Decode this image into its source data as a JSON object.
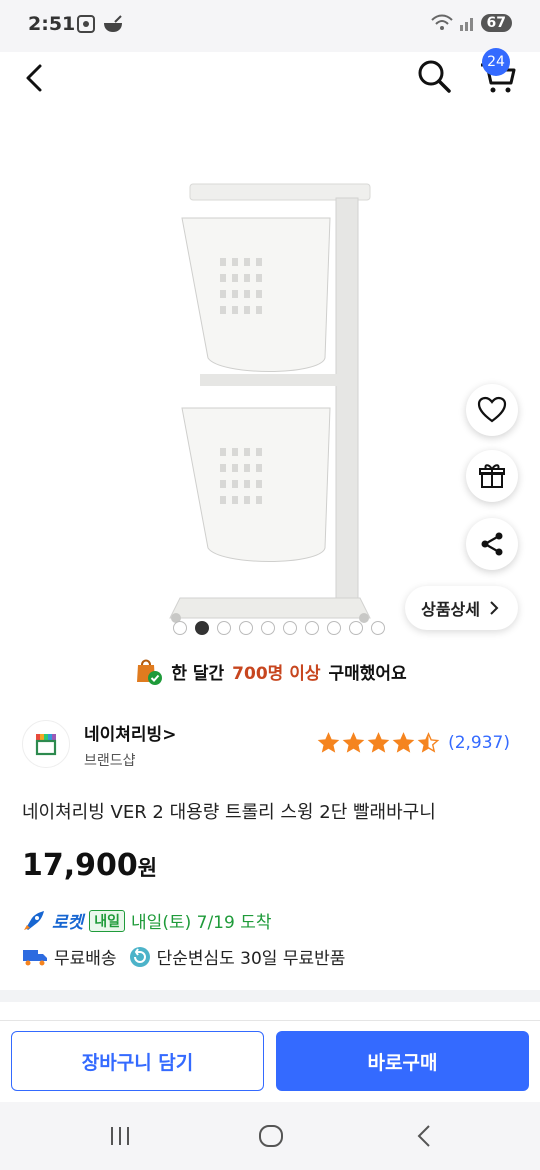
{
  "status_bar": {
    "time": "2:51",
    "battery": "67"
  },
  "header": {
    "cart_count": "24"
  },
  "gallery": {
    "total_images": 10,
    "active_index": 1
  },
  "actions": {
    "detail_label": "상품상세"
  },
  "purchase_banner": {
    "prefix": "한 달간",
    "highlight": "700명 이상",
    "suffix": "구매했어요"
  },
  "brand": {
    "name": "네이쳐리빙",
    "chevron": ">",
    "sub": "브랜드샵"
  },
  "rating": {
    "stars": 4.5,
    "review_count": "(2,937)"
  },
  "product": {
    "title": "네이쳐리빙 VER 2 대용량 트롤리 스윙 2단 빨래바구니",
    "price": "17,900",
    "price_unit": "원"
  },
  "delivery": {
    "rocket": "로켓",
    "tomorrow": "내일",
    "date": "내일(토) 7/19 도착",
    "free_shipping": "무료배송",
    "free_return": "단순변심도 30일 무료반품"
  },
  "buttons": {
    "add_to_cart": "장바구니 담기",
    "buy_now": "바로구매"
  },
  "colors": {
    "accent": "#346aff",
    "delivery_green": "#1f9b3a",
    "highlight": "#c7461f",
    "star": "#f5841f"
  }
}
